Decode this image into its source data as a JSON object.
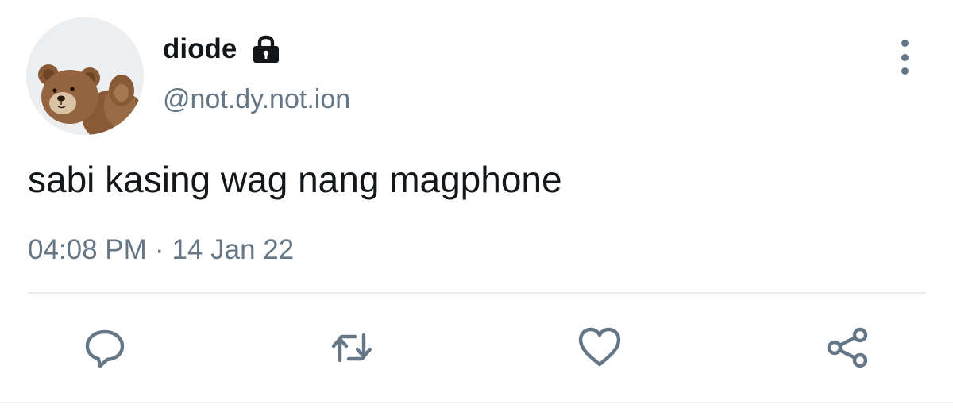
{
  "user": {
    "display_name": "diode",
    "handle": "@not.dy.not.ion",
    "protected_icon": "lock-icon",
    "avatar_icon": "teddy-bear-avatar"
  },
  "tweet": {
    "text": "sabi kasing wag nang magphone",
    "time": "04:08 PM",
    "separator": "·",
    "date": "14 Jan 22"
  },
  "actions": {
    "reply_icon": "speech-bubble-icon",
    "retweet_icon": "retweet-icon",
    "like_icon": "heart-icon",
    "share_icon": "share-icon"
  },
  "menu": {
    "more_icon": "vertical-dots-icon"
  },
  "colors": {
    "text_primary": "#14171a",
    "text_secondary": "#657786",
    "icon": "#657786",
    "divider": "#e6ecf0",
    "background": "#ffffff"
  }
}
